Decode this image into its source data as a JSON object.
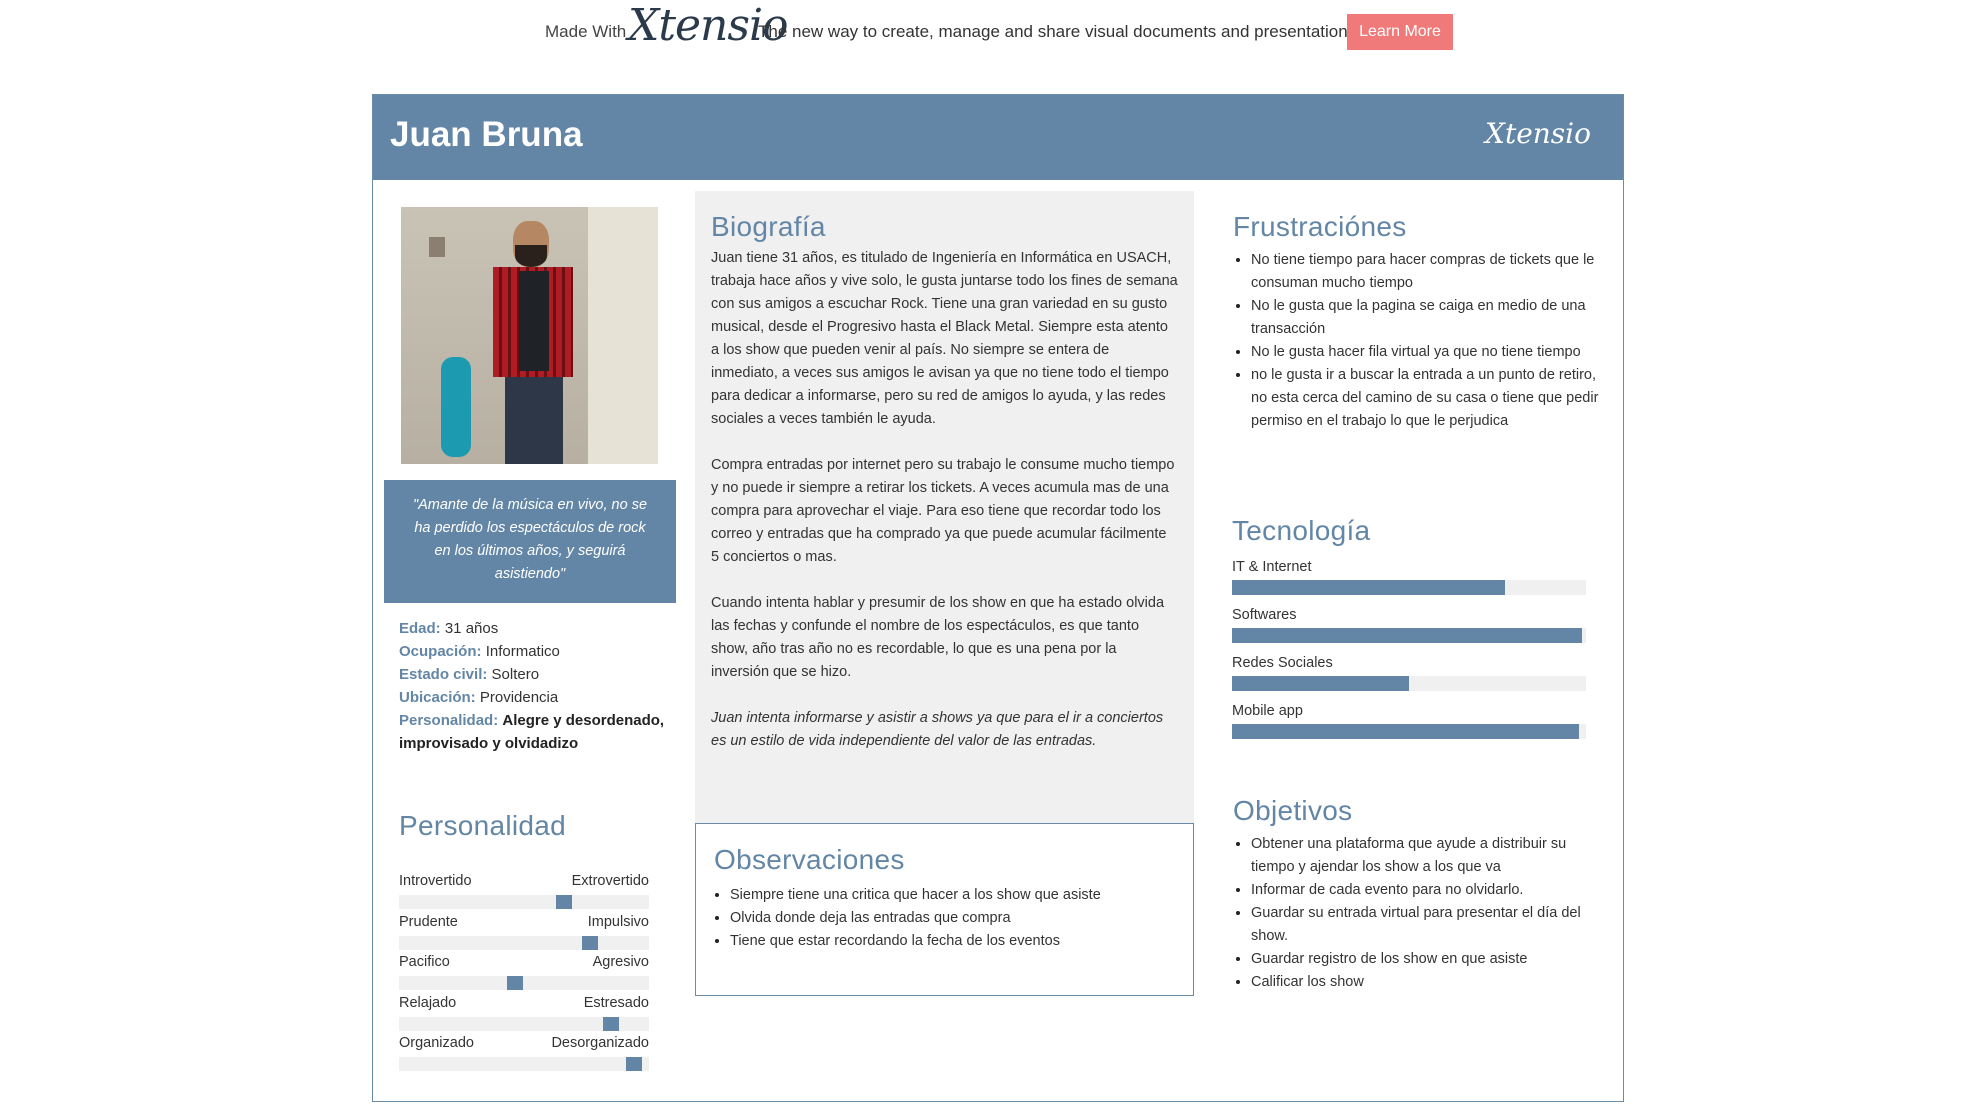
{
  "promo": {
    "made_with": "Made With",
    "logo": "Xtensio",
    "tagline": "The new way to create, manage and share visual documents and presentations.",
    "learn_more": "Learn More"
  },
  "header": {
    "name": "Juan Bruna",
    "logo": "Xtensio"
  },
  "colors": {
    "accent": "#6386a6",
    "cta": "#f07a7a",
    "panel": "#f0f0f0"
  },
  "quote": "\"Amante de la música en vivo, no se ha perdido los espectáculos de rock en los últimos años, y seguirá asistiendo\"",
  "facts": {
    "edad_label": "Edad:",
    "edad": "31 años",
    "ocupacion_label": "Ocupación:",
    "ocupacion": "Informatico",
    "estado_label": "Estado civil:",
    "estado": "Soltero",
    "ubicacion_label": "Ubicación:",
    "ubicacion": "Providencia",
    "personalidad_label": "Personalidad:",
    "personalidad": "Alegre y desordenado, improvisado y olvidadizo"
  },
  "personality": {
    "title": "Personalidad",
    "sliders": [
      {
        "left": "Introvertido",
        "right": "Extrovertido",
        "value": 0.67
      },
      {
        "left": "Prudente",
        "right": "Impulsivo",
        "value": 0.78
      },
      {
        "left": "Pacifico",
        "right": "Agresivo",
        "value": 0.46
      },
      {
        "left": "Relajado",
        "right": "Estresado",
        "value": 0.87
      },
      {
        "left": "Organizado",
        "right": "Desorganizado",
        "value": 0.97
      }
    ]
  },
  "bio": {
    "title": "Biografía",
    "p1": "Juan tiene 31 años, es titulado de Ingeniería en Informática en USACH, trabaja hace años y vive solo, le gusta juntarse todo los fines de semana con sus amigos a escuchar Rock. Tiene una gran variedad en su gusto musical, desde el Progresivo hasta el Black Metal. Siempre esta atento a los show que pueden venir al país. No siempre se entera de inmediato, a veces sus amigos le avisan ya que no tiene todo el tiempo para dedicar a informarse, pero su red de amigos lo ayuda, y las redes sociales a veces también le ayuda.",
    "p2": "Compra entradas por internet pero su trabajo le consume mucho tiempo y no puede ir siempre a retirar los tickets. A veces acumula mas de una compra para aprovechar el viaje. Para eso tiene que recordar todo los correo y entradas que ha comprado ya que puede acumular fácilmente 5 conciertos o mas.",
    "p3": "Cuando intenta hablar y presumir de los show en que ha estado olvida las fechas y confunde el nombre de los espectáculos, es que tanto show, año tras año no es recordable, lo que es una pena por la inversión que se hizo.",
    "p4": "Juan intenta informarse y asistir a shows ya que para el ir a conciertos es un estilo de vida independiente del valor de las entradas."
  },
  "observations": {
    "title": "Observaciones",
    "items": [
      "Siempre tiene una critica que hacer a los show que asiste",
      "Olvida donde deja las entradas que compra",
      "Tiene que estar recordando la fecha de los eventos"
    ]
  },
  "frustrations": {
    "title": "Frustraciónes",
    "items": [
      "No tiene tiempo para hacer compras de tickets que le consuman mucho tiempo",
      "No le gusta que la pagina se caiga en medio de una transacción",
      "No le gusta hacer fila virtual ya que no tiene tiempo",
      "no le gusta ir a buscar la entrada a un punto de retiro, no esta cerca del camino de su casa o tiene que pedir permiso en el trabajo lo que le perjudica"
    ]
  },
  "technology": {
    "title": "Tecnología",
    "bars": [
      {
        "label": "IT & Internet",
        "value": 0.77
      },
      {
        "label": "Softwares",
        "value": 0.99
      },
      {
        "label": "Redes Sociales",
        "value": 0.5
      },
      {
        "label": "Mobile app",
        "value": 0.98
      }
    ]
  },
  "goals": {
    "title": "Objetivos",
    "items": [
      "Obtener una plataforma que ayude a distribuir su tiempo y ajendar los show a los que va",
      "Informar de cada evento para no olvidarlo.",
      "Guardar su entrada virtual para presentar el día del show.",
      "Guardar registro de los show en que asiste",
      "Calificar los show"
    ]
  }
}
